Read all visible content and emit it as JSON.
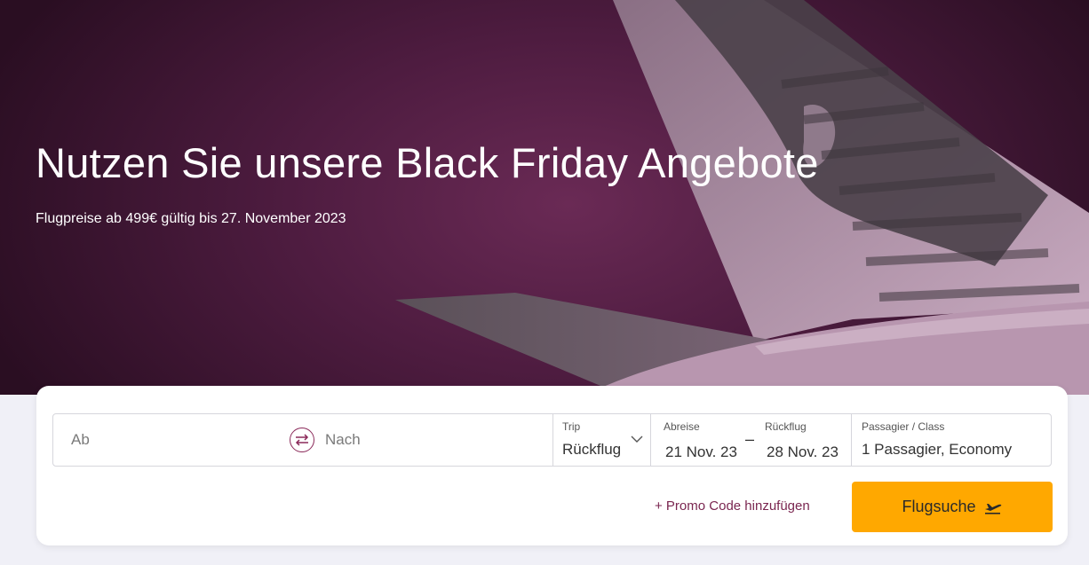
{
  "hero": {
    "title": "Nutzen Sie unsere Black Friday Angebote",
    "subtitle": "Flugpreise ab 499€ gültig bis 27. November 2023"
  },
  "search": {
    "from_placeholder": "Ab",
    "to_placeholder": "Nach",
    "trip_label": "Trip",
    "trip_value": "Rückflug",
    "departure_label": "Abreise",
    "departure_value": "21 Nov. 23",
    "return_label": "Rückflug",
    "return_value": "28 Nov. 23",
    "date_separator": "–",
    "passenger_label": "Passagier / Class",
    "passenger_value": "1 Passagier, Economy",
    "promo_label": "+ Promo Code hinzufügen",
    "search_button": "Flugsuche"
  },
  "icons": {
    "swap": "swap-arrows-icon",
    "trip_dropdown": "chevron-down-icon",
    "search": "airplane-takeoff-icon"
  },
  "colors": {
    "brand": "#5c0632",
    "accent_button": "#ffa800",
    "hero_bg": "#4e1c40"
  }
}
